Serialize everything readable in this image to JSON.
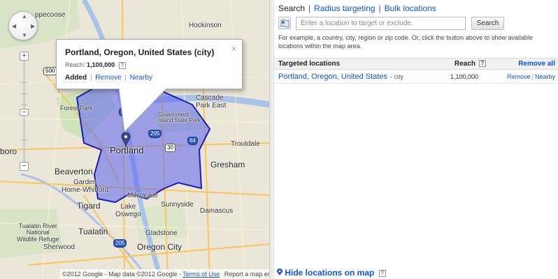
{
  "map": {
    "popup": {
      "title": "Portland, Oregon, United States (city)",
      "reach_label": "Reach:",
      "reach_value": "1,100,000",
      "help": "?",
      "added": "Added",
      "remove": "Remove",
      "nearby": "Nearby",
      "close": "×"
    },
    "zoom_in": "+",
    "zoom_out": "−",
    "footer": {
      "copyright": "©2012 Google - Map data ©2012 Google -",
      "terms": "Terms of Use",
      "report": "Report a map error"
    },
    "labels": {
      "tippecanoe": "ppecoose",
      "hockinson": "Hockinson",
      "cascade_park_east": "Cascade\nPark East",
      "forest_park": "Forest Park",
      "government_island": "Government\nIsland State Park",
      "portland": "Portland",
      "troutdale": "Troutdale",
      "boro": "boro",
      "beaverton": "Beaverton",
      "gresham": "Gresham",
      "garden_home": "Garden\nHome-Whitford",
      "milwaukie": "Milwaukie",
      "sunnyside": "Sunnyside",
      "tigard": "Tigard",
      "lake_oswego": "Lake\nOswego",
      "damascus": "Damascus",
      "tualatin_river": "Tualatin River\nNational\nWildlife Refuge",
      "tualatin": "Tualatin",
      "gladstone": "Gladstone",
      "sherwood": "Sherwood",
      "oregon_city": "Oregon City"
    },
    "shields": [
      "500",
      "5",
      "205",
      "84",
      "30",
      "205"
    ]
  },
  "panel": {
    "tabs": {
      "search": "Search",
      "radius": "Radius targeting",
      "bulk": "Bulk locations",
      "separator": "|"
    },
    "search": {
      "placeholder": "Enter a location to target or exclude.",
      "button": "Search"
    },
    "hint": "For example, a country, city, region or zip code. Or, click the button above to show available locations within the map area.",
    "table": {
      "col_location": "Targeted locations",
      "col_reach": "Reach",
      "help": "?",
      "remove_all": "Remove all",
      "rows": [
        {
          "location": "Portland, Oregon, United States",
          "type": "- city",
          "reach": "1,100,000",
          "remove": "Remove",
          "nearby": "Nearby"
        }
      ]
    },
    "hide_map": "Hide locations on map",
    "help": "?"
  },
  "colors": {
    "link": "#1155cc",
    "region_fill": "#5b63f0",
    "region_stroke": "#1a1fb0",
    "map_bg": "#ece6d8"
  }
}
